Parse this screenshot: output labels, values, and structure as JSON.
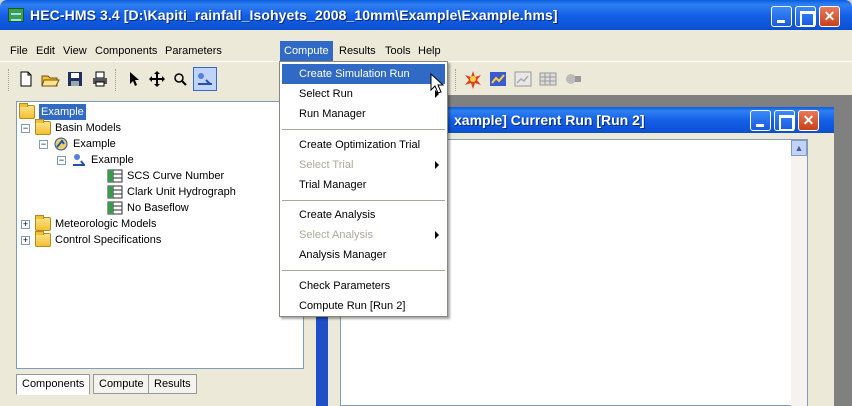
{
  "window": {
    "title": "HEC-HMS 3.4 [D:\\Kapiti_rainfall_Isohyets_2008_10mm\\Example\\Example.hms]"
  },
  "menubar": [
    {
      "label": "File"
    },
    {
      "label": "Edit"
    },
    {
      "label": "View"
    },
    {
      "label": "Components"
    },
    {
      "label": "Parameters"
    },
    {
      "label": "Compute"
    },
    {
      "label": "Results"
    },
    {
      "label": "Tools"
    },
    {
      "label": "Help"
    }
  ],
  "compute_menu": {
    "items": [
      {
        "label": "Create Simulation Run",
        "highlighted": true
      },
      {
        "label": "Select Run",
        "submenu": true
      },
      {
        "label": "Run Manager"
      },
      {
        "label": "Create Optimization Trial"
      },
      {
        "label": "Select Trial",
        "disabled": true,
        "submenu": true
      },
      {
        "label": "Trial Manager"
      },
      {
        "label": "Create Analysis"
      },
      {
        "label": "Select Analysis",
        "disabled": true,
        "submenu": true
      },
      {
        "label": "Analysis Manager"
      },
      {
        "label": "Check Parameters"
      },
      {
        "label": "Compute Run [Run 2]"
      }
    ]
  },
  "tree": {
    "root": "Example",
    "basin_models": "Basin Models",
    "basin_example": "Example",
    "subbasin_example": "Example",
    "methods": [
      "SCS Curve Number",
      "Clark Unit Hydrograph",
      "No Baseflow"
    ],
    "meteorologic_models": "Meteorologic Models",
    "control_specifications": "Control Specifications"
  },
  "tabs": [
    {
      "label": "Components",
      "active": true
    },
    {
      "label": "Compute"
    },
    {
      "label": "Results"
    }
  ],
  "child_window": {
    "title": "xample]  Current Run [Run 2]"
  },
  "colors": {
    "titlebar_blue": "#0a5ee0",
    "highlight": "#316ac5",
    "menu_bg": "#ece9d8"
  }
}
